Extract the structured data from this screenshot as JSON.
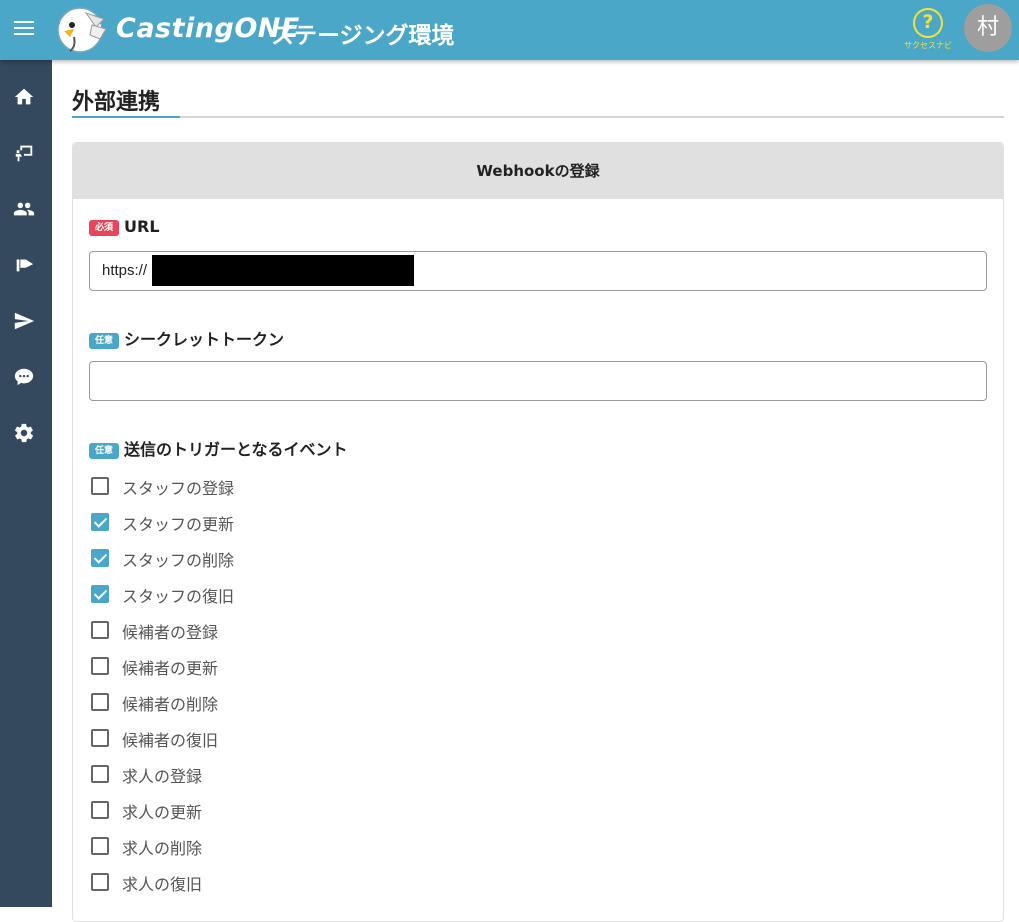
{
  "header": {
    "logo_text": "CastingONE",
    "env_label": "ステージング環境",
    "help_label": "サクセスナビ",
    "avatar_initial": "村",
    "colors": {
      "bar": "#4ba7c8",
      "help": "#f3e33b"
    }
  },
  "sidebar": {
    "items": [
      {
        "icon": "home-icon"
      },
      {
        "icon": "job-board-icon"
      },
      {
        "icon": "people-icon"
      },
      {
        "icon": "flag-icon"
      },
      {
        "icon": "send-icon"
      },
      {
        "icon": "chat-icon"
      },
      {
        "icon": "settings-icon"
      }
    ],
    "color": "#34495e"
  },
  "page": {
    "title": "外部連携"
  },
  "form": {
    "card_title": "Webhookの登録",
    "required_badge": "必須",
    "optional_badge": "任意",
    "url": {
      "label": "URL",
      "value": "https://"
    },
    "secret_token": {
      "label": "シークレットトークン",
      "value": ""
    },
    "triggers": {
      "label": "送信のトリガーとなるイベント",
      "options": [
        {
          "label": "スタッフの登録",
          "checked": false
        },
        {
          "label": "スタッフの更新",
          "checked": true
        },
        {
          "label": "スタッフの削除",
          "checked": true
        },
        {
          "label": "スタッフの復旧",
          "checked": true
        },
        {
          "label": "候補者の登録",
          "checked": false
        },
        {
          "label": "候補者の更新",
          "checked": false
        },
        {
          "label": "候補者の削除",
          "checked": false
        },
        {
          "label": "候補者の復旧",
          "checked": false
        },
        {
          "label": "求人の登録",
          "checked": false
        },
        {
          "label": "求人の更新",
          "checked": false
        },
        {
          "label": "求人の削除",
          "checked": false
        },
        {
          "label": "求人の復旧",
          "checked": false
        }
      ]
    }
  }
}
